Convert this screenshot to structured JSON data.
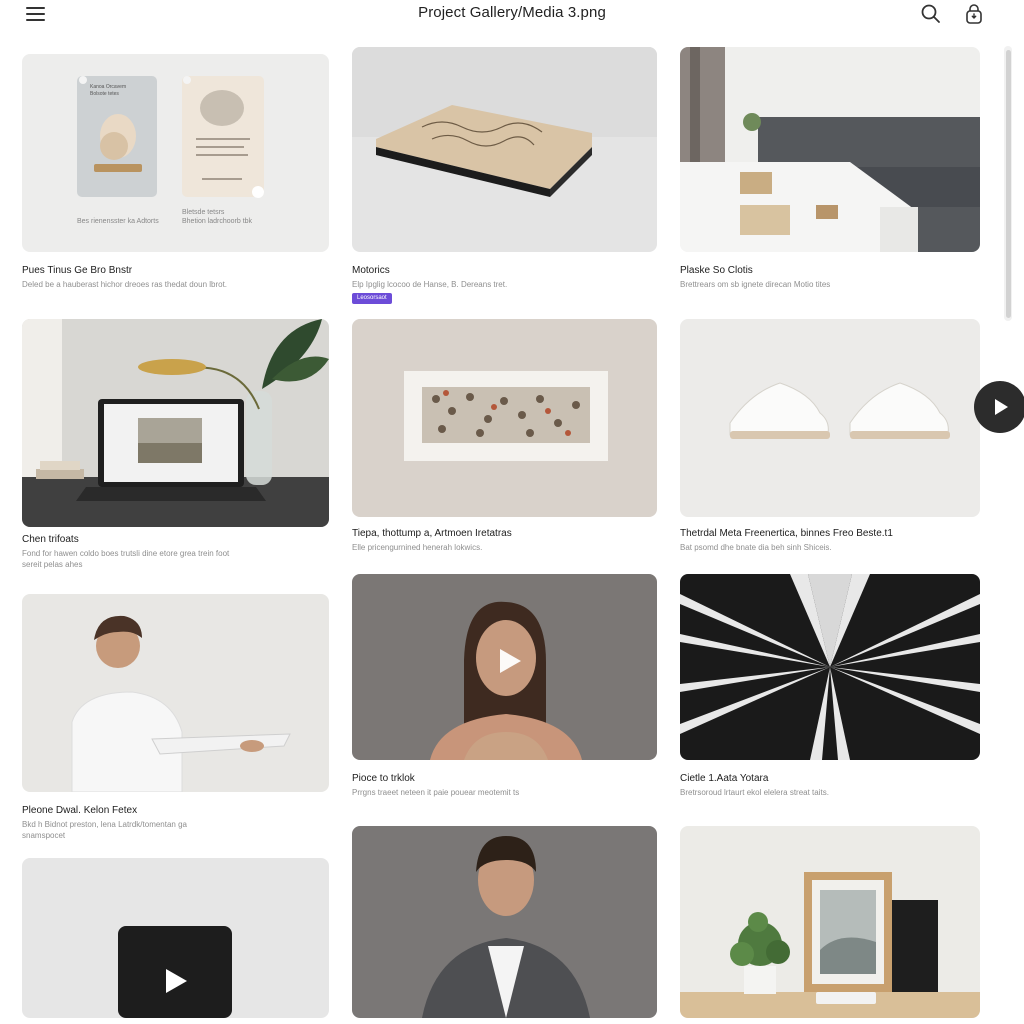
{
  "header": {
    "title": "Project Gallery/Media 3.png"
  },
  "colors": {
    "accent": "#6c4cd8",
    "dark_button": "#2c2c2c",
    "background": "#ffffff"
  },
  "icons": {
    "menu": "hamburger-icon",
    "search": "search-icon",
    "lock": "lock-icon",
    "play": "play-icon"
  },
  "cards": [
    {
      "title": "Pues Tinus Ge Bro Bnstr",
      "desc": [
        "Deled be a hauberast hichor dreoes ras thedat doun lbrot."
      ],
      "mock_lines": [
        "Kanoa Orcavem",
        "Bolsote tetes",
        "Bes rienensster ka Adtorts",
        "Bletsde tetsrs",
        "Bhetion ladrchoorb tbk"
      ]
    },
    {
      "title": "Motorics",
      "desc": [
        "Elp Ipglig lcocoo de Hanse, B. Dereans tret."
      ],
      "tag": "Leosorsaot"
    },
    {
      "title": "Plaske So Clotis",
      "desc": [
        "Brettrears om sb ignete direcan Motio tites"
      ]
    },
    {
      "title": "Chen trifoats",
      "desc": [
        "Fond for hawen coldo boes trutsli dine etore grea trein foot",
        "sereit pelas ahes"
      ]
    },
    {
      "title": "Tiepa, thottump a, Artmoen Iretatras",
      "desc": [
        "Elle pricengurnined henerah lokwics."
      ]
    },
    {
      "title": "Thetrdal Meta Freenertica, binnes Freo Beste.t1",
      "desc": [
        "Bat psomd dhe bnate dia beh sinh Shiceis."
      ]
    },
    {
      "title": "Pleone Dwal. Kelon Fetex",
      "desc": [
        "Bkd h Bidnot preston, lena Latrdk/tomentan ga",
        "snamspocet"
      ]
    },
    {
      "title": "Pioce to trklok",
      "desc": [
        "Prrgns traeet neteen it paie pouear meotemit ts"
      ]
    },
    {
      "title": "Cietle 1.Aata Yotara",
      "desc": [
        "Bretrsoroud lrtaurt ekol elelera streat taits."
      ]
    },
    {
      "title": "",
      "desc": []
    },
    {
      "title": "",
      "desc": []
    },
    {
      "title": "",
      "desc": []
    }
  ]
}
